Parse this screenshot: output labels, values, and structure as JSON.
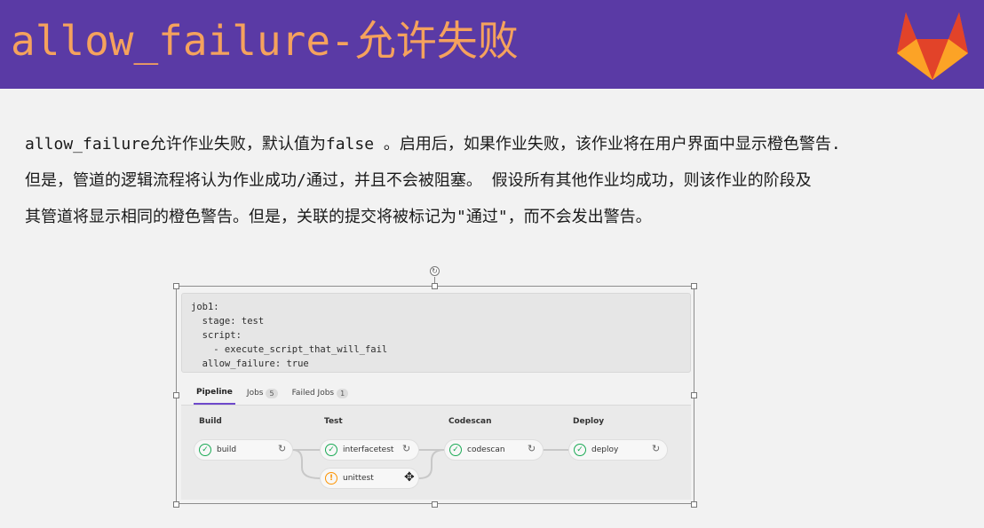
{
  "banner": {
    "title": "allow_failure-允许失败",
    "logo_icon": "gitlab-logo-icon",
    "colors": {
      "background": "#5a3aa5",
      "title": "#f5a25d"
    }
  },
  "intro": {
    "lines": [
      "allow_failure允许作业失败，默认值为false 。启用后，如果作业失败，该作业将在用户界面中显示橙色警告.",
      "但是，管道的逻辑流程将认为作业成功/通过，并且不会被阻塞。 假设所有其他作业均成功，则该作业的阶段及",
      "其管道将显示相同的橙色警告。但是，关联的提交将被标记为\"通过\"，而不会发出警告。"
    ]
  },
  "code": {
    "lines": [
      "job1:",
      "  stage: test",
      "  script:",
      "    - execute_script_that_will_fail",
      "  allow_failure: true"
    ]
  },
  "tabs": [
    {
      "label": "Pipeline",
      "count": null,
      "active": true
    },
    {
      "label": "Jobs",
      "count": "5",
      "active": false
    },
    {
      "label": "Failed Jobs",
      "count": "1",
      "active": false
    }
  ],
  "stages": [
    {
      "title": "Build",
      "jobs": [
        {
          "name": "build",
          "status": "passed"
        }
      ]
    },
    {
      "title": "Test",
      "jobs": [
        {
          "name": "interfacetest",
          "status": "passed"
        },
        {
          "name": "unittest",
          "status": "warning"
        }
      ]
    },
    {
      "title": "Codescan",
      "jobs": [
        {
          "name": "codescan",
          "status": "passed"
        }
      ]
    },
    {
      "title": "Deploy",
      "jobs": [
        {
          "name": "deploy",
          "status": "passed"
        }
      ]
    }
  ],
  "icons": {
    "passed": "✓",
    "warning": "!",
    "retry": "↻",
    "rotate": "↻",
    "cursor": "✥"
  },
  "status_colors": {
    "passed": "#1aaa55",
    "warning": "#fc9403",
    "tab_active": "#6e49cb"
  }
}
